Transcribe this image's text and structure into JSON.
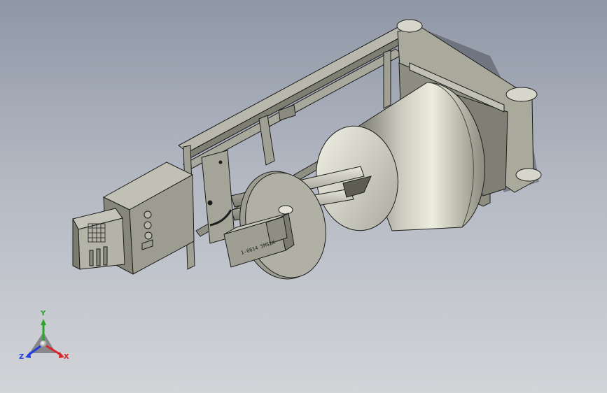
{
  "scene": {
    "model_label_text": "1-6614 SMS2X",
    "colors": {
      "bg_top": "#8f97a6",
      "bg_bottom": "#d2d4d8",
      "body_metal": "#9a9a8c",
      "body_dark": "#6e6f64",
      "drum_light": "#e6e6da",
      "drum_dark": "#7b7b6f",
      "outline": "#1c1c1c"
    }
  },
  "triad": {
    "x_label": "X",
    "y_label": "Y",
    "z_label": "Z",
    "x_color": "#d8262a",
    "y_color": "#2aa52a",
    "z_color": "#2240d8"
  }
}
